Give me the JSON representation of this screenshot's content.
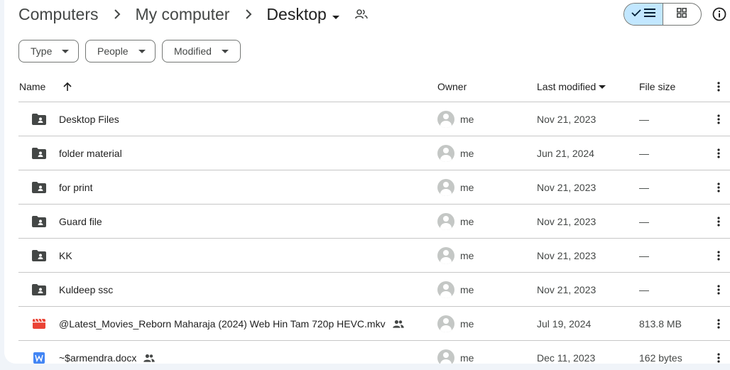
{
  "breadcrumb": {
    "items": [
      "Computers",
      "My computer"
    ],
    "current": "Desktop"
  },
  "filters": [
    "Type",
    "People",
    "Modified"
  ],
  "view": {
    "active": "list"
  },
  "table": {
    "headers": {
      "name": "Name",
      "owner": "Owner",
      "last_modified": "Last modified",
      "file_size": "File size"
    },
    "rows": [
      {
        "icon": "folder-icon",
        "name": "Desktop Files",
        "owner": "me",
        "modified": "Nov 21, 2023",
        "size": "—",
        "shared": false
      },
      {
        "icon": "folder-icon",
        "name": "folder material",
        "owner": "me",
        "modified": "Jun 21, 2024",
        "size": "—",
        "shared": false
      },
      {
        "icon": "folder-icon",
        "name": "for print",
        "owner": "me",
        "modified": "Nov 21, 2023",
        "size": "—",
        "shared": false
      },
      {
        "icon": "folder-icon",
        "name": "Guard file",
        "owner": "me",
        "modified": "Nov 21, 2023",
        "size": "—",
        "shared": false
      },
      {
        "icon": "folder-icon",
        "name": "KK",
        "owner": "me",
        "modified": "Nov 21, 2023",
        "size": "—",
        "shared": false
      },
      {
        "icon": "folder-icon",
        "name": "Kuldeep ssc",
        "owner": "me",
        "modified": "Nov 21, 2023",
        "size": "—",
        "shared": false
      },
      {
        "icon": "video-icon",
        "name": "@Latest_Movies_Reborn Maharaja (2024) Web Hin Tam 720p HEVC.mkv",
        "owner": "me",
        "modified": "Jul 19, 2024",
        "size": "813.8 MB",
        "shared": true
      },
      {
        "icon": "word-doc-icon",
        "name": "~$armendra.docx",
        "owner": "me",
        "modified": "Dec 11, 2023",
        "size": "162 bytes",
        "shared": true
      }
    ]
  },
  "colors": {
    "accent_toggle": "#c2e7ff",
    "video_icon": "#ea4335",
    "word_icon": "#4285f4",
    "folder_icon": "#444746"
  }
}
